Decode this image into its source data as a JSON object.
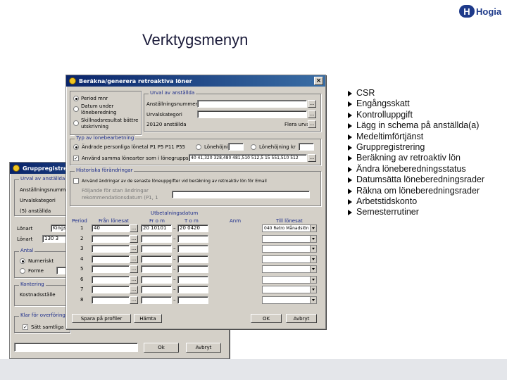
{
  "slide": {
    "title": "Verktygsmenyn",
    "logo_text": "Hogia",
    "logo_badge": "H"
  },
  "bullets": [
    "CSR",
    "Engångsskatt",
    "Kontrolluppgift",
    "Lägg in schema på anställda(a)",
    "Medeltimförtjänst",
    "Gruppregistrering",
    "Beräkning av retroaktiv lön",
    "Ändra löneberedningsstatus",
    "Datumsätta löneberedningsrader",
    "Räkna om löneberedningsrader",
    "Arbetstidskonto",
    "Semesterrutiner"
  ],
  "back_window": {
    "title": "Gruppregistrering",
    "urval_label": "Urval av anställda",
    "anstallningsnummer": "Anställningsnummer",
    "urvalskategori": "Urvalskategori",
    "anstallda": "(5) anställda",
    "lonart_label": "Lönart",
    "lonart_value": "Kings",
    "lonperiod_label": "Lönart",
    "lonperiod_value": "130 3",
    "antal_label": "Antal",
    "numeriskt": "Numeriskt",
    "forme": "Forme",
    "kontering_label": "Kontering",
    "kostnadsstalle": "Kostnadsställe",
    "klar_label": "Klar för overföring",
    "satt_label": "Sätt samtliga",
    "ok": "Ok",
    "avbryt": "Avbryt"
  },
  "front_window": {
    "title": "Beräkna/generera retroaktiva löner",
    "radio1": "Period mnr",
    "radio2": "Datum under löneberedning",
    "radio3": "Skillnadsresultat bättre utskrivning",
    "urval_label": "Urval av anställda",
    "anstallningsnummer": "Anställningsnummer",
    "urvalskategori": "Urvalskategori",
    "anstallda": "20120 anställda",
    "flera_urval": "Flera urval",
    "typ_label": "Typ av lonebearbetning",
    "ordinarie": "Ändrade personliga lönetal P1 P5 P11 P55",
    "lonehojning_pct": "Lönehöjning %",
    "lonehojning_kr": "Lönehöjning kr",
    "anvand_label": "Använd samma lönearter som i lönegruppsraden",
    "lonearter_value": "40 41,320 328,480 481,510 512,5 15 551,510 512",
    "historiska_label": "Historiska förändringar",
    "hist_check": "Använd ändringar av de senaste löneuppgifter vid beräkning av retroaktiv lön för Email",
    "foljande_label": "Följande för stan ändringar",
    "forandr_label": "rekommendationsdatum (P1, 1",
    "col_period": "Period",
    "col_fran": "Från lönesat",
    "col_utbet": "Utbetalningsdatum",
    "col_from": "Fr o m",
    "col_tom": "T o m",
    "col_anm": "Anm",
    "col_till": "Till lönesat",
    "rows": [
      {
        "n": "1",
        "fran": "40",
        "from": "20 10101",
        "tom": "20  0420",
        "till": "040 Retro Månadslön"
      },
      {
        "n": "2",
        "fran": "",
        "from": "",
        "tom": "",
        "till": ""
      },
      {
        "n": "3",
        "fran": "",
        "from": "",
        "tom": "",
        "till": ""
      },
      {
        "n": "4",
        "fran": "",
        "from": "",
        "tom": "",
        "till": ""
      },
      {
        "n": "5",
        "fran": "",
        "from": "",
        "tom": "",
        "till": ""
      },
      {
        "n": "6",
        "fran": "",
        "from": "",
        "tom": "",
        "till": ""
      },
      {
        "n": "7",
        "fran": "",
        "from": "",
        "tom": "",
        "till": ""
      },
      {
        "n": "8",
        "fran": "",
        "from": "",
        "tom": "",
        "till": ""
      }
    ],
    "spara": "Spara på profiler",
    "hamta": "Hämta",
    "ok": "OK",
    "avbryt": "Avbryt",
    "dots": "..."
  }
}
